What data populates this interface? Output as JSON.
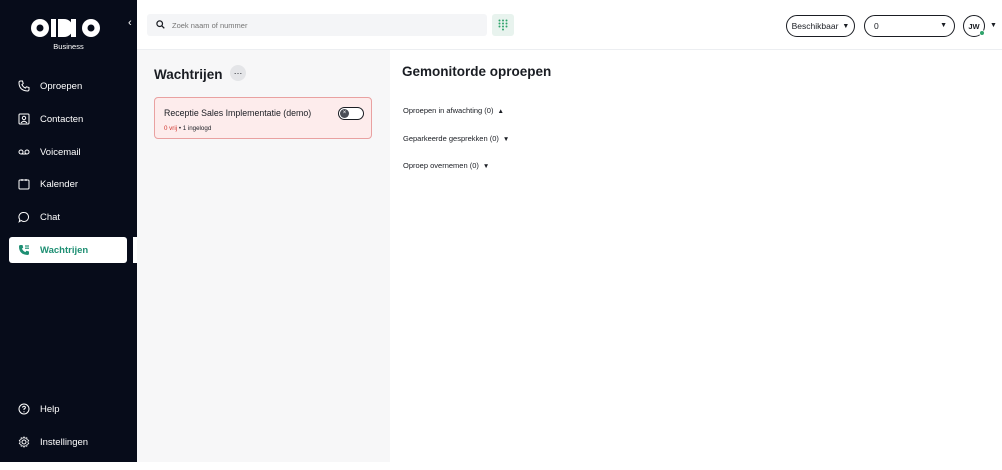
{
  "app": {
    "logo_text": "ODIDO",
    "logo_sub": "Business",
    "collapse_icon": "chevron-left-icon"
  },
  "sidebar": {
    "items": [
      {
        "label": "Oproepen",
        "icon": "phone-icon"
      },
      {
        "label": "Contacten",
        "icon": "contact-card-icon"
      },
      {
        "label": "Voicemail",
        "icon": "voicemail-icon"
      },
      {
        "label": "Kalender",
        "icon": "calendar-icon"
      },
      {
        "label": "Chat",
        "icon": "chat-bubble-icon"
      },
      {
        "label": "Wachtrijen",
        "icon": "queue-phone-icon",
        "active": true
      }
    ],
    "bottom_items": [
      {
        "label": "Help",
        "icon": "help-icon"
      },
      {
        "label": "Instellingen",
        "icon": "gear-icon"
      }
    ]
  },
  "search": {
    "placeholder": "Zoek naam of nummer",
    "icon": "search-icon"
  },
  "topbar": {
    "status_label": "Beschikbaar",
    "device_value": "0",
    "avatar_initials": "JW",
    "dialpad_icon": "dialpad-icon"
  },
  "queues": {
    "title": "Wachtrijen",
    "more_icon": "ellipsis-icon",
    "items": [
      {
        "name": "Receptie Sales Implementatie (demo)",
        "free": "0 vrij",
        "logged_in": "1 ingelogd",
        "toggle_on": false
      }
    ]
  },
  "monitored": {
    "title": "Gemonitorde oproepen",
    "sections": [
      {
        "label": "Oproepen in afwachting (0)",
        "expanded": true
      },
      {
        "label": "Geparkeerde gesprekken (0)",
        "expanded": false
      },
      {
        "label": "Oproep overnemen (0)",
        "expanded": false
      }
    ]
  },
  "colors": {
    "sidebar_bg": "#070c1a",
    "accent": "#1e8f73",
    "alert_border": "#e9a1a1",
    "alert_bg": "#fdecec",
    "alert_text": "#d0342c",
    "presence": "#2fa36b"
  }
}
